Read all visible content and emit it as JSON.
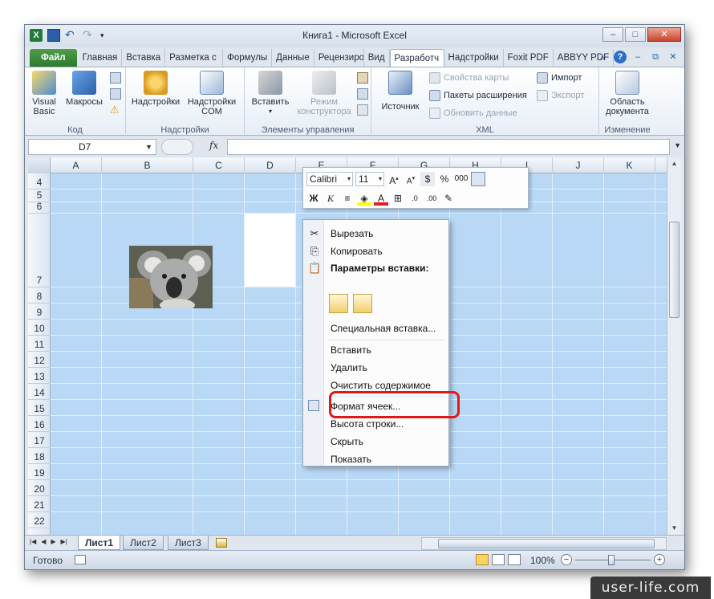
{
  "window": {
    "title": "Книга1  -  Microsoft Excel"
  },
  "tabs": [
    "Файл",
    "Главная",
    "Вставка",
    "Разметка с",
    "Формулы",
    "Данные",
    "Рецензиро",
    "Вид",
    "Разработч",
    "Надстройки",
    "Foxit PDF",
    "ABBYY PDF"
  ],
  "ribbon": {
    "code": {
      "label": "Код",
      "visual_basic": "Visual Basic",
      "macros": "Макросы"
    },
    "addins": {
      "label": "Надстройки",
      "addins": "Надстройки",
      "com_addins": "Надстройки COM"
    },
    "controls": {
      "label": "Элементы управления",
      "insert": "Вставить",
      "design_mode": "Режим конструктора"
    },
    "xml": {
      "label": "XML",
      "source": "Источник",
      "map_props": "Свойства карты",
      "ext_packs": "Пакеты расширения",
      "refresh": "Обновить данные",
      "import": "Импорт",
      "export": "Экспорт"
    },
    "modify": {
      "label": "Изменение",
      "doc_panel": "Область документа"
    }
  },
  "formula_bar": {
    "name_box": "D7",
    "fx": "fx",
    "formula": ""
  },
  "columns": [
    "A",
    "B",
    "C",
    "D",
    "E",
    "F",
    "G",
    "H",
    "I",
    "J",
    "K"
  ],
  "rows": [
    "4",
    "5",
    "6",
    "7",
    "8",
    "9",
    "10",
    "11",
    "12",
    "13",
    "14",
    "15",
    "16",
    "17",
    "18",
    "19",
    "20",
    "21",
    "22"
  ],
  "mini_toolbar": {
    "font": "Calibri",
    "size": "11",
    "bold": "Ж",
    "italic": "К",
    "percent": "%",
    "thousands": "000"
  },
  "context_menu": {
    "cut": "Вырезать",
    "copy": "Копировать",
    "paste_options": "Параметры вставки:",
    "paste_special": "Специальная вставка...",
    "insert": "Вставить",
    "delete": "Удалить",
    "clear": "Очистить содержимое",
    "format_cells": "Формат ячеек...",
    "row_height": "Высота строки...",
    "hide": "Скрыть",
    "unhide": "Показать"
  },
  "sheets": [
    "Лист1",
    "Лист2",
    "Лист3"
  ],
  "status": {
    "ready": "Готово",
    "zoom": "100%"
  },
  "watermark": "user-life.com"
}
